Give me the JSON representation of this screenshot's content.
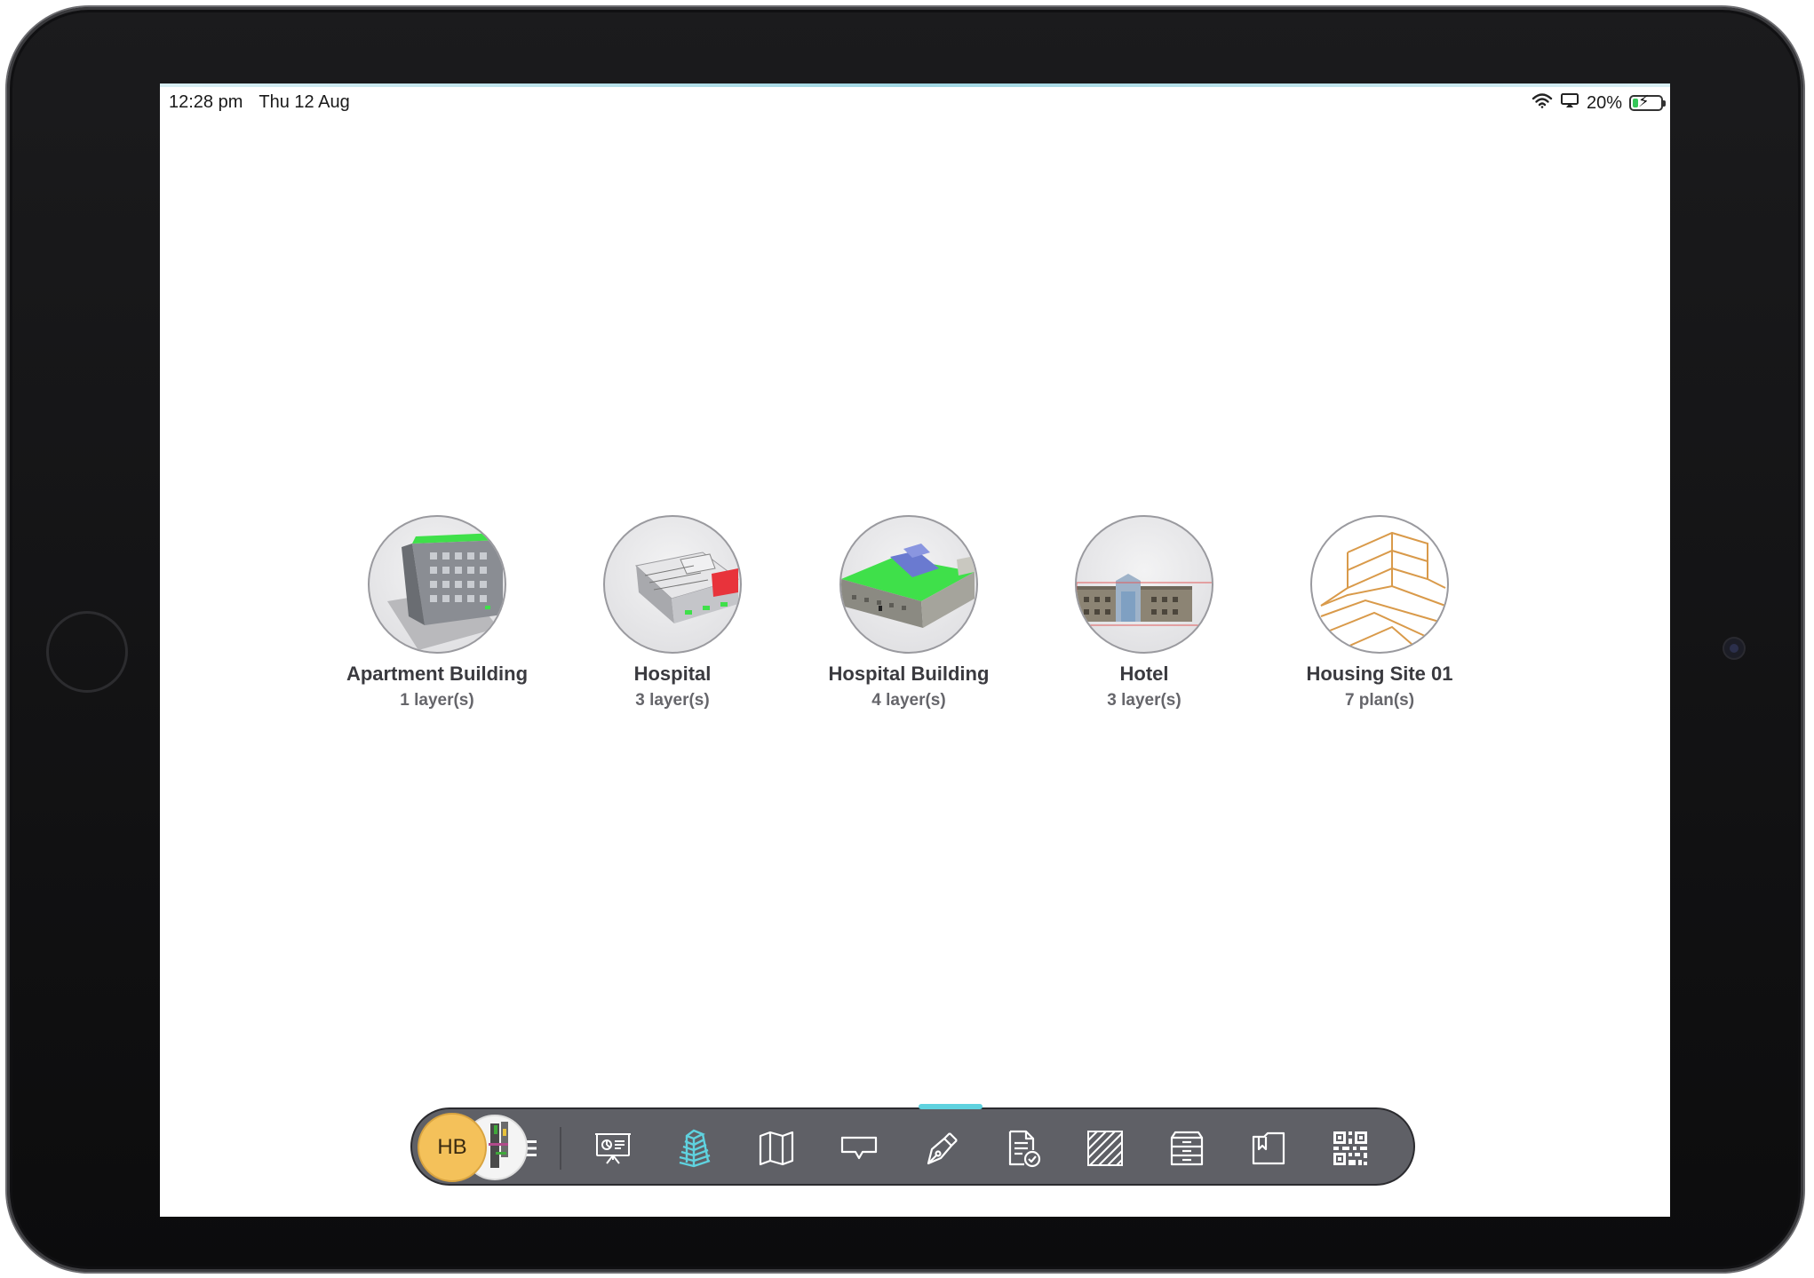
{
  "status_bar": {
    "time": "12:28 pm",
    "date": "Thu 12 Aug",
    "battery_percent_label": "20%",
    "battery_level": 0.2,
    "icons": [
      "wifi-icon",
      "airplay-icon",
      "battery-charging-icon"
    ]
  },
  "projects": [
    {
      "name": "Apartment Building",
      "subtitle": "1 layer(s)",
      "thumbnail": "apartment-building-thumbnail"
    },
    {
      "name": "Hospital",
      "subtitle": "3 layer(s)",
      "thumbnail": "hospital-thumbnail"
    },
    {
      "name": "Hospital Building",
      "subtitle": "4 layer(s)",
      "thumbnail": "hospital-building-thumbnail"
    },
    {
      "name": "Hotel",
      "subtitle": "3 layer(s)",
      "thumbnail": "hotel-thumbnail"
    },
    {
      "name": "Housing Site 01",
      "subtitle": "7 plan(s)",
      "thumbnail": "housing-site-thumbnail"
    }
  ],
  "toolbar": {
    "avatar_initials": "HB",
    "active_tool": "buildings",
    "tools": [
      "presentation-board-icon",
      "buildings-stack-icon",
      "map-icon",
      "comment-icon",
      "pen-icon",
      "checked-document-icon",
      "hatch-pattern-icon",
      "archive-drawers-icon",
      "bookmark-folder-icon",
      "qr-code-icon"
    ]
  },
  "colors": {
    "accent": "#5fd2df",
    "toolbar_bg": "#5f6066",
    "avatar": "#f4c15a",
    "battery": "#35c759"
  }
}
